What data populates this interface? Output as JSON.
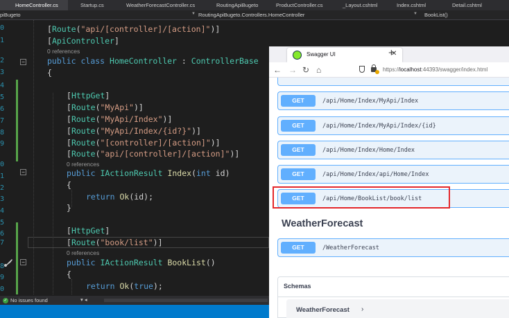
{
  "vs": {
    "tabs": [
      {
        "label": "HomeController.cs",
        "active": true
      },
      {
        "label": "Startup.cs"
      },
      {
        "label": "WeatherForecastController.cs"
      },
      {
        "label": "RoutingApiBugeto"
      },
      {
        "label": "ProductController.cs"
      },
      {
        "label": "_Layout.cshtml"
      },
      {
        "label": "Index.cshtml"
      },
      {
        "label": "Detail.cshtml"
      }
    ],
    "nav": {
      "project": "piBugeto",
      "class": "RoutingApiBugeto.Controllers.HomeController",
      "member": "BookList()"
    },
    "line_numbers": [
      "0",
      "1",
      "",
      "2",
      "3",
      "4",
      "5",
      "6",
      "7",
      "8",
      "9",
      "",
      "0",
      "1",
      "2",
      "3",
      "4",
      "5",
      "6",
      "7",
      "",
      "8",
      "9",
      "0",
      "1"
    ],
    "code": {
      "l1_attr": "Route",
      "l1_str": "\"api/[controller]/[action]\"",
      "l2_attr": "ApiController",
      "refs1": "0 references",
      "l3_kw1": "public",
      "l3_kw2": "class",
      "l3_type": "HomeController",
      "l3_base": "ControllerBase",
      "brace_open": "{",
      "brace_close": "}",
      "httpget": "HttpGet",
      "route": "Route",
      "r1": "\"MyApi\"",
      "r2": "\"MyApi/Index\"",
      "r3": "\"MyApi/Index/{id?}\"",
      "r4": "\"[controller]/[action]\"",
      "r5": "\"api/[controller]/[action]\"",
      "refs2": "0 references",
      "m1_kw": "public",
      "m1_type": "IActionResult",
      "m1_name": "Index",
      "m1_param_type": "int",
      "m1_param": "id",
      "return_kw": "return",
      "ok": "Ok",
      "m1_arg": "id",
      "r6": "\"book/list\"",
      "refs3": "0 references",
      "m2_name": "BookList",
      "m2_arg": "true"
    },
    "status": {
      "issues": "No issues found"
    }
  },
  "browser": {
    "tab_title": "Swagger UI",
    "url_prefix": "https://",
    "url_host": "localhost",
    "url_rest": ":44393/swagger/index.html",
    "operations": [
      {
        "method": "GET",
        "path": "/api/Home/Index/MyApi/Index"
      },
      {
        "method": "GET",
        "path": "/api/Home/Index/MyApi/Index/{id}"
      },
      {
        "method": "GET",
        "path": "/api/Home/Index/Home/Index"
      },
      {
        "method": "GET",
        "path": "/api/Home/Index/api/Home/Index"
      },
      {
        "method": "GET",
        "path": "/api/Home/BookList/book/list"
      }
    ],
    "section_title": "WeatherForecast",
    "weather_op": {
      "method": "GET",
      "path": "/WeatherForecast"
    },
    "schemas_title": "Schemas",
    "schema_model": "WeatherForecast",
    "colors": {
      "get_method": "#61affe",
      "get_bg": "#ebf3fb",
      "highlight_border": "#e3272b",
      "vs_blue": "#007acc"
    }
  }
}
